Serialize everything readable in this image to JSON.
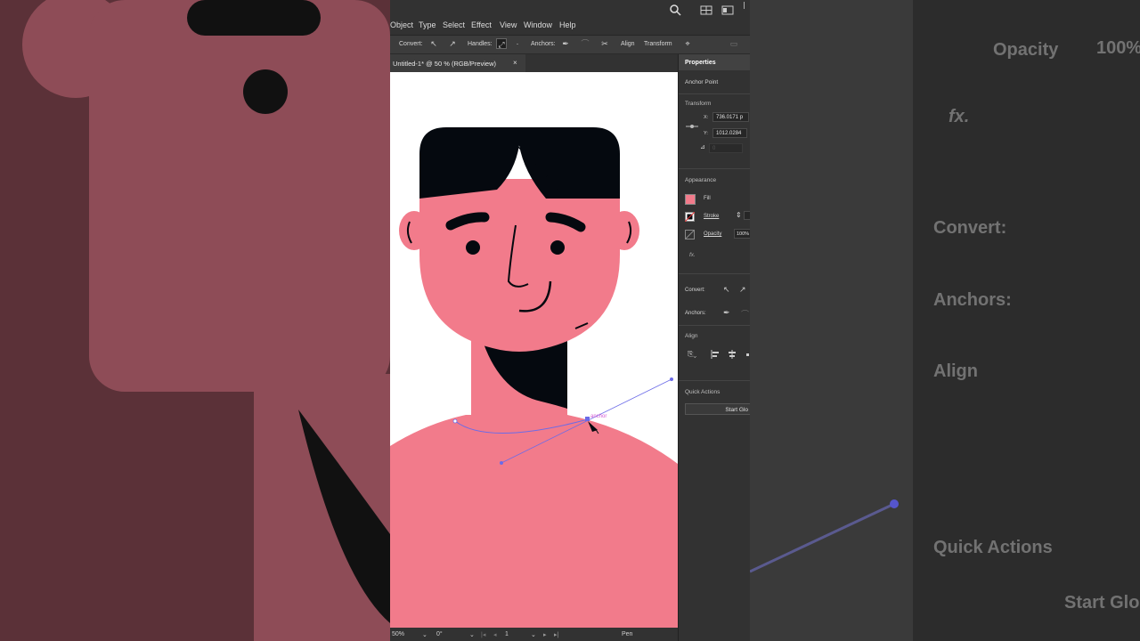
{
  "menubar": {
    "items": [
      "Object",
      "Type",
      "Select",
      "Effect",
      "View",
      "Window",
      "Help"
    ]
  },
  "control_bar": {
    "convert_label": "Convert:",
    "handles_label": "Handles:",
    "anchors_label": "Anchors:",
    "align_label": "Align",
    "transform_label": "Transform"
  },
  "document": {
    "tab_title": "Untitled-1* @ 50 % (RGB/Preview)",
    "close_glyph": "×",
    "anchor_hint": "anchor"
  },
  "status": {
    "zoom": "50%",
    "rotation": "0°",
    "artboard": "1",
    "tool": "Pen"
  },
  "properties": {
    "tab": "Properties",
    "selection": "Anchor Point",
    "transform_title": "Transform",
    "x_label": "X:",
    "x_value": "736.0171 p",
    "y_label": "Y:",
    "y_value": "1012.0284",
    "angle_value": "0",
    "appearance_title": "Appearance",
    "fill_label": "Fill",
    "stroke_label": "Stroke",
    "opacity_label": "Opacity",
    "opacity_value": "100%",
    "fx_label": "fx.",
    "convert_label": "Convert:",
    "anchors_label": "Anchors:",
    "align_title": "Align",
    "quick_actions_title": "Quick Actions",
    "start_button": "Start Glo"
  },
  "background_right": {
    "opacity_label": "Opacity",
    "opacity_value": "100%",
    "fx_label": "fx.",
    "convert_label": "Convert:",
    "anchors_label": "Anchors:",
    "align_label": "Align",
    "quick_actions_label": "Quick Actions",
    "start_label": "Start Glo"
  },
  "colors": {
    "skin": "#f27b8b",
    "hair": "#05090f",
    "ui_dark": "#323232",
    "ui_mid": "#535353",
    "path_blue": "#6b6be8",
    "anchor_magenta": "#d45ad4"
  }
}
